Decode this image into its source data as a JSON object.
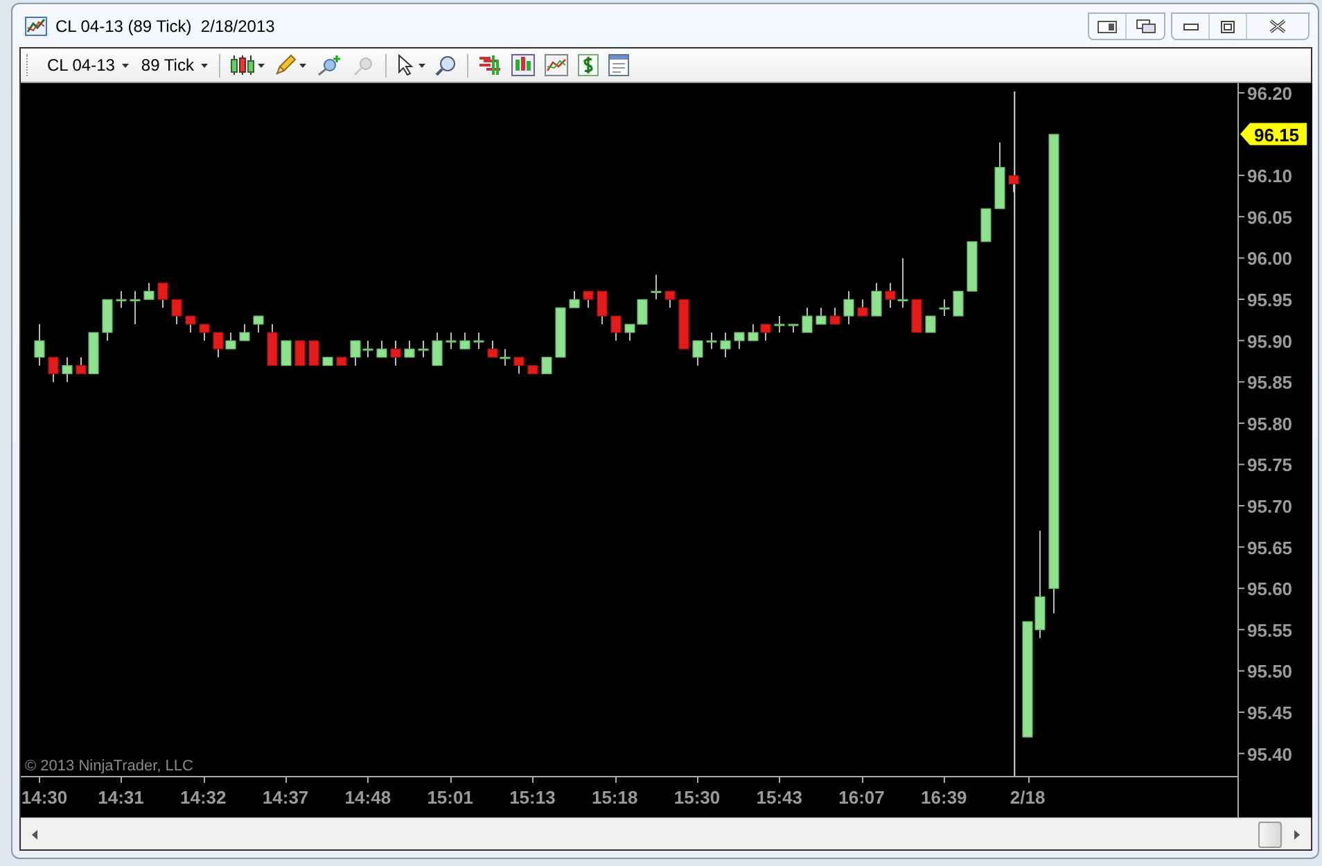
{
  "window": {
    "title": "CL 04-13 (89 Tick)  2/18/2013"
  },
  "toolbar": {
    "instrument": "CL 04-13",
    "interval": "89 Tick"
  },
  "chart": {
    "copyright": "© 2013 NinjaTrader, LLC",
    "price_axis": [
      {
        "kind": "tick",
        "label": "96.20"
      },
      {
        "kind": "last-price",
        "label": "96.15"
      },
      {
        "kind": "tick",
        "label": "96.10"
      },
      {
        "kind": "tick",
        "label": "96.05"
      },
      {
        "kind": "tick",
        "label": "96.00"
      },
      {
        "kind": "tick",
        "label": "95.95"
      },
      {
        "kind": "tick",
        "label": "95.90"
      },
      {
        "kind": "tick",
        "label": "95.85"
      },
      {
        "kind": "tick",
        "label": "95.80"
      },
      {
        "kind": "tick",
        "label": "95.75"
      },
      {
        "kind": "tick",
        "label": "95.70"
      },
      {
        "kind": "tick",
        "label": "95.65"
      },
      {
        "kind": "tick",
        "label": "95.60"
      },
      {
        "kind": "tick",
        "label": "95.55"
      },
      {
        "kind": "tick",
        "label": "95.50"
      },
      {
        "kind": "tick",
        "label": "95.45"
      },
      {
        "kind": "tick",
        "label": "95.40"
      }
    ],
    "time_axis": [
      "14:30",
      "14:31",
      "14:32",
      "14:37",
      "14:48",
      "15:01",
      "15:13",
      "15:18",
      "15:30",
      "15:43",
      "16:07",
      "16:39",
      "2/18"
    ]
  }
}
